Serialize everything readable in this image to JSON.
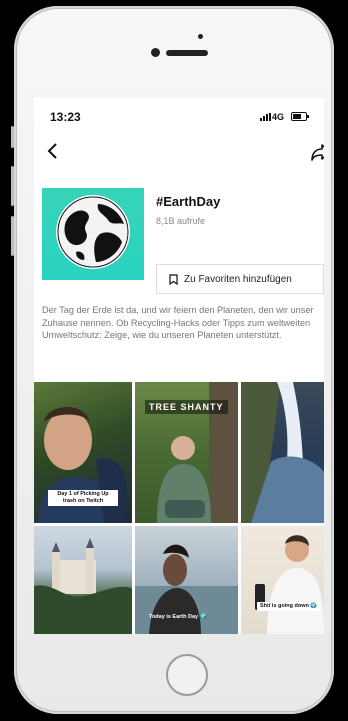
{
  "status": {
    "time": "13:23",
    "network": "4G"
  },
  "hashtag": {
    "title": "#EarthDay",
    "views": "8,1B aufrufe",
    "favorite_label": "Zu Favoriten hinzufügen",
    "description": "Der Tag der Erde ist da, und wir feiern den Planeten, den wir unser Zuhause nennen. Ob Recycling-Hacks oder Tipps zum weltweiten Umweltschutz: Zeige, wie du unseren Planeten unterstützt."
  },
  "videos": [
    {
      "caption": "Day 1 of Picking Up trash on Twitch"
    },
    {
      "caption": "TREE SHANTY"
    },
    {
      "caption": ""
    },
    {
      "caption": ""
    },
    {
      "caption": "Today is Earth Day 🌍"
    },
    {
      "caption": "Shit is going down 🌍"
    }
  ],
  "colors": {
    "cover_bg": "#2ad2c2",
    "text_secondary": "#777777"
  },
  "icons": [
    "back-arrow-icon",
    "share-icon",
    "bookmark-icon",
    "earth-icon",
    "signal-icon",
    "battery-icon"
  ]
}
